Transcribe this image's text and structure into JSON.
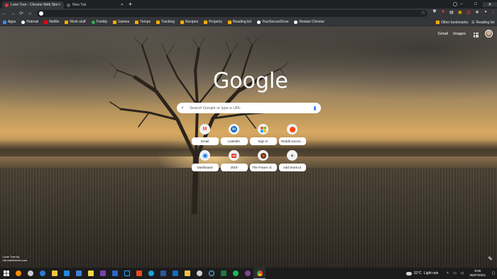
{
  "tabs": [
    {
      "label": "Lone Tree - Chrome Web Store",
      "favicon_color": "#e53935"
    },
    {
      "label": "New Tab",
      "favicon_color": "#5f6368"
    }
  ],
  "window_controls": {
    "minimize": "–",
    "maximize": "□",
    "close": "✕"
  },
  "toolbar": {
    "back": "←",
    "forward": "→",
    "reload": "⟳",
    "home": "⌂",
    "omnibox_value": "",
    "star": "☆"
  },
  "bookmarks": [
    {
      "label": "Apps",
      "color": "#4285f4"
    },
    {
      "label": "Hotmail",
      "color": "#ffffff"
    },
    {
      "label": "Netflix",
      "color": "#e50914"
    },
    {
      "label": "Work stuff",
      "color": "#f9ab00"
    },
    {
      "label": "Freddy",
      "color": "#34a853"
    },
    {
      "label": "Games",
      "color": "#f9ab00"
    },
    {
      "label": "Temps",
      "color": "#f9ab00"
    },
    {
      "label": "Tracking",
      "color": "#f9ab00"
    },
    {
      "label": "Recipes",
      "color": "#f9ab00"
    },
    {
      "label": "Property",
      "color": "#f9ab00"
    },
    {
      "label": "Reading list",
      "color": "#f9ab00"
    },
    {
      "label": "YourSoccerDose",
      "color": "#ffffff"
    },
    {
      "label": "Restart Chrome",
      "color": "#ffffff"
    }
  ],
  "bookmarks_right": {
    "other": "Other bookmarks",
    "reading": "Reading list"
  },
  "ntp": {
    "gmail": "Gmail",
    "images": "Images",
    "logo": "Google",
    "search_placeholder": "Search Google or type a URL",
    "shortcuts": [
      {
        "label": "Gmail",
        "glyph": "M",
        "color": "#ea4335"
      },
      {
        "label": "LinkedIn",
        "glyph": "in",
        "color": "#0a66c2"
      },
      {
        "label": "Sign In",
        "glyph": "▦",
        "color": "#f25022"
      },
      {
        "label": "Reddit soccer...",
        "glyph": "●",
        "color": "#ff4500"
      },
      {
        "label": "Dashboard",
        "glyph": "◉",
        "color": "#1976d2"
      },
      {
        "label": "2019",
        "glyph": "vid",
        "color": "#e53935"
      },
      {
        "label": "The Future of...",
        "glyph": "◉",
        "color": "#c0582e"
      },
      {
        "label": "Add shortcut",
        "glyph": "+",
        "color": "#202124"
      }
    ],
    "credit_line1": "Lone Tree by",
    "credit_line2": "chromethemer.com"
  },
  "taskbar": {
    "weather_temp": "31°C",
    "weather_desc": "Light rain",
    "time": "9:06",
    "date": "06/07/2021",
    "icons": [
      {
        "name": "windows-start-icon",
        "color": "#ffffff"
      },
      {
        "name": "search-icon",
        "color": "#ff8c00"
      },
      {
        "name": "settings-icon",
        "color": "#cccccc"
      },
      {
        "name": "edge-icon",
        "color": "#2b7bd9"
      },
      {
        "name": "file-explorer-icon",
        "color": "#f5c242"
      },
      {
        "name": "mail-icon",
        "color": "#1e88e5"
      },
      {
        "name": "store-icon",
        "color": "#3f7fd8"
      },
      {
        "name": "sticky-notes-icon",
        "color": "#f7d64a"
      },
      {
        "name": "onenote-icon",
        "color": "#7b3fb0"
      },
      {
        "name": "photos-icon",
        "color": "#2a68c8"
      },
      {
        "name": "photoshop-icon",
        "color": "#001e36"
      },
      {
        "name": "office-icon",
        "color": "#e84a1f"
      },
      {
        "name": "edge-browser-icon",
        "color": "#1ca0d8"
      },
      {
        "name": "word-icon",
        "color": "#2b579a"
      },
      {
        "name": "outlook-icon",
        "color": "#0f6cbd"
      },
      {
        "name": "files-icon",
        "color": "#f5c242"
      },
      {
        "name": "xbox-icon",
        "color": "#cfcfcf"
      },
      {
        "name": "steam-icon",
        "color": "#1b2838"
      },
      {
        "name": "excel-icon",
        "color": "#217346"
      },
      {
        "name": "spotify-icon",
        "color": "#1db954"
      },
      {
        "name": "tor-icon",
        "color": "#7e4798"
      },
      {
        "name": "chrome-icon",
        "color": "#fbbc05"
      }
    ]
  }
}
